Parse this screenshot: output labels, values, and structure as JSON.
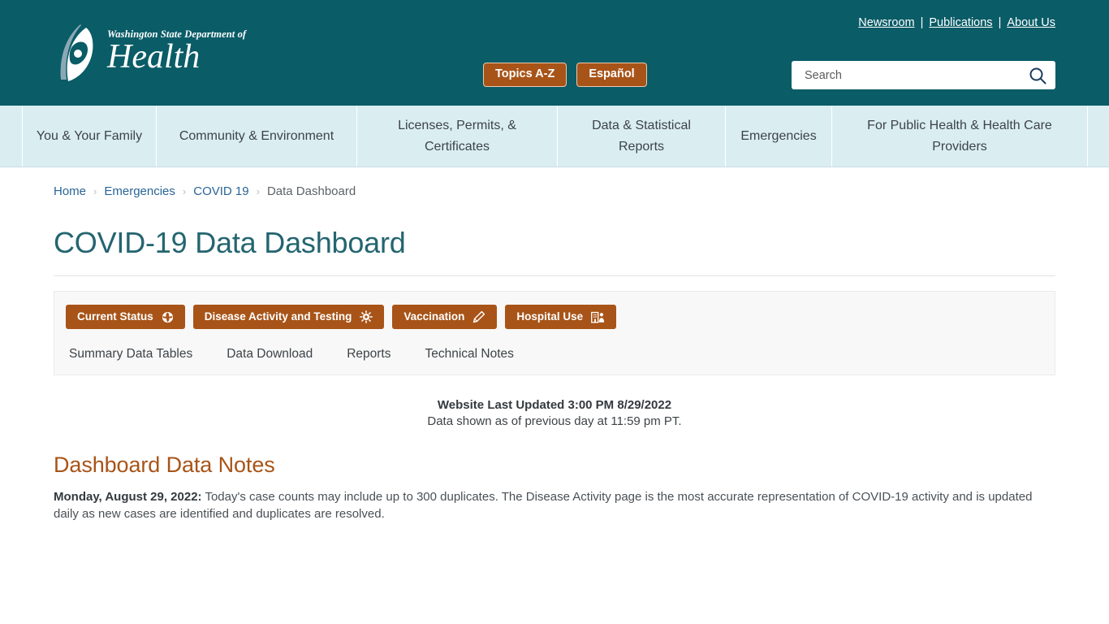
{
  "header": {
    "logo": {
      "line1": "Washington State Department of",
      "line2": "Health",
      "alt": "Washington State Department of Health"
    },
    "util_links": [
      {
        "label": "Newsroom"
      },
      {
        "label": "Publications"
      },
      {
        "label": "About Us"
      }
    ],
    "util_separator": "|",
    "buttons": [
      {
        "label": "Topics A-Z"
      },
      {
        "label": "Español"
      }
    ],
    "search": {
      "placeholder": "Search",
      "value": "",
      "icon": "search-icon"
    },
    "colors": {
      "teal": "#0a5c67",
      "orange": "#a85418",
      "nav_blue": "#daeef2"
    }
  },
  "main_nav": {
    "items": [
      {
        "label": "You & Your Family"
      },
      {
        "label": "Community & Environment"
      },
      {
        "label": "Licenses, Permits, & Certificates"
      },
      {
        "label": "Data & Statistical Reports"
      },
      {
        "label": "Emergencies"
      },
      {
        "label": "For Public Health & Health Care Providers"
      }
    ]
  },
  "breadcrumb": {
    "items": [
      {
        "label": "Home",
        "link": true
      },
      {
        "label": "Emergencies",
        "link": true
      },
      {
        "label": "COVID 19",
        "link": true
      },
      {
        "label": "Data Dashboard",
        "link": false
      }
    ],
    "separator": "›"
  },
  "page": {
    "title": "COVID-19 Data Dashboard"
  },
  "dashboard_tabs": {
    "buttons": [
      {
        "label": "Current Status",
        "icon": "globe-icon"
      },
      {
        "label": "Disease Activity and Testing",
        "icon": "virus-icon"
      },
      {
        "label": "Vaccination",
        "icon": "syringe-icon"
      },
      {
        "label": "Hospital Use",
        "icon": "hospital-icon"
      }
    ],
    "sub_links": [
      {
        "label": "Summary Data Tables"
      },
      {
        "label": "Data Download"
      },
      {
        "label": "Reports"
      },
      {
        "label": "Technical Notes"
      }
    ]
  },
  "updated": {
    "primary": "Website Last Updated 3:00 PM 8/29/2022",
    "secondary": "Data shown as of previous day at 11:59 pm PT."
  },
  "notes": {
    "heading": "Dashboard Data Notes",
    "date_label": "Monday, August 29, 2022:",
    "body": " Today's case counts may include up to 300 duplicates. The Disease Activity page is the most accurate representation of COVID-19 activity and is updated daily as new cases are identified and duplicates are resolved."
  }
}
